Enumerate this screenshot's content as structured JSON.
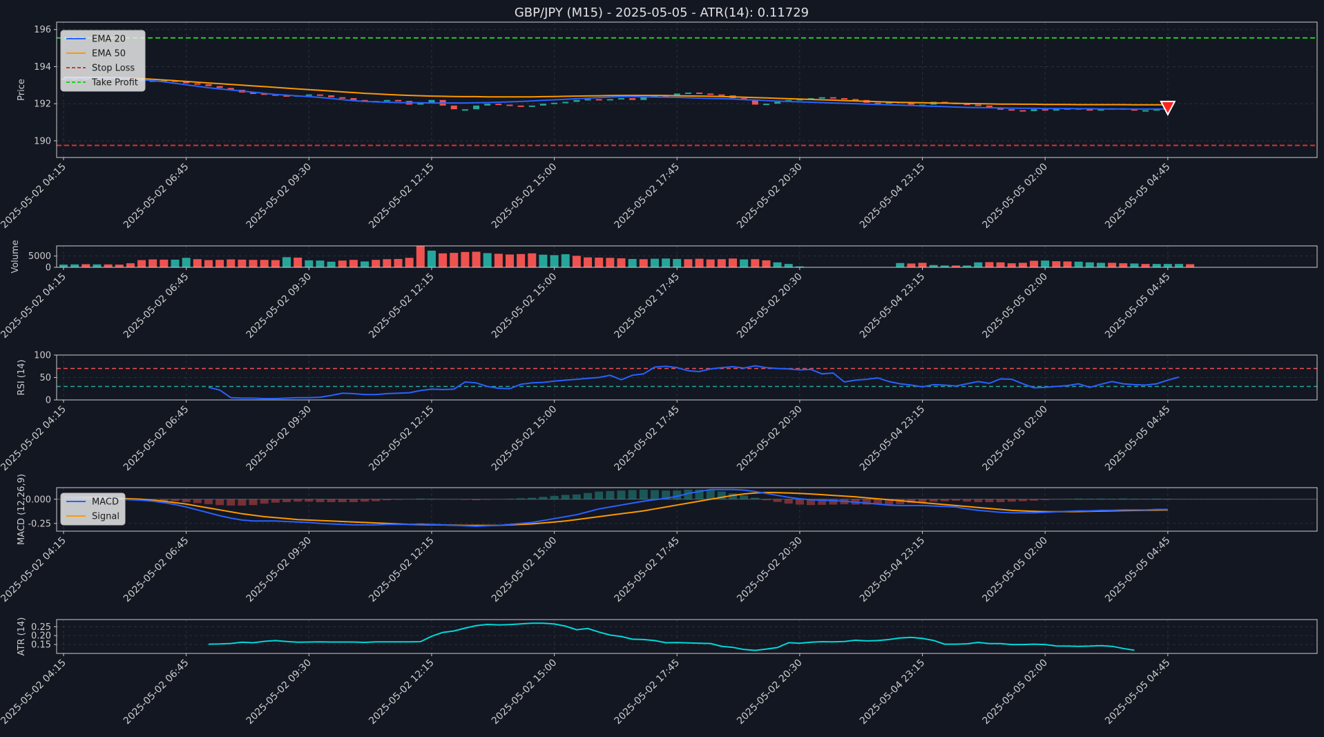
{
  "title": "GBP/JPY (M15) - 2025-05-05 - ATR(14): 0.11729",
  "theme": {
    "background": "#131722",
    "axis_color": "#cccccc",
    "grid_color": "#2a2f3d",
    "up_color": "#26a69a",
    "down_color": "#ef5350",
    "ema20_color": "#2962ff",
    "ema50_color": "#ff9800",
    "stop_loss_color": "#e03030",
    "take_profit_color": "#22cc22",
    "rsi_upper_color": "#ef5350",
    "rsi_lower_color": "#26a69a",
    "atr_color": "#00d9d9"
  },
  "x_ticks": [
    "2025-05-02 04:15",
    "2025-05-02 06:45",
    "2025-05-02 09:30",
    "2025-05-02 12:15",
    "2025-05-02 15:00",
    "2025-05-02 17:45",
    "2025-05-02 20:30",
    "2025-05-04 23:15",
    "2025-05-05 02:00",
    "2025-05-05 04:45"
  ],
  "chart_data": [
    {
      "type": "candlestick",
      "ylabel": "Price",
      "ylim": [
        189.1,
        196.4
      ],
      "yticks": [
        190,
        192,
        194,
        196
      ],
      "legend": [
        "EMA 20",
        "EMA 50",
        "Stop Loss",
        "Take Profit"
      ],
      "legend_position": "top-left",
      "stop_loss": 189.75,
      "take_profit": 195.55,
      "signal_marker": {
        "type": "sell",
        "bar": 99,
        "price": 191.75
      },
      "close": [
        193.35,
        193.35,
        193.35,
        193.35,
        193.3,
        193.3,
        193.3,
        193.25,
        193.25,
        193.25,
        193.2,
        193.1,
        193.05,
        192.95,
        192.85,
        192.75,
        192.6,
        192.55,
        192.5,
        192.45,
        192.4,
        192.45,
        192.5,
        192.45,
        192.35,
        192.3,
        192.2,
        192.1,
        192.15,
        192.2,
        192.15,
        191.95,
        192.05,
        192.2,
        191.9,
        191.7,
        191.7,
        191.9,
        192.0,
        191.95,
        191.9,
        191.85,
        191.9,
        192.0,
        192.05,
        192.1,
        192.2,
        192.25,
        192.2,
        192.25,
        192.3,
        192.2,
        192.35,
        192.45,
        192.4,
        192.55,
        192.6,
        192.55,
        192.5,
        192.45,
        192.3,
        192.2,
        191.95,
        192.0,
        192.1,
        192.2,
        192.25,
        192.3,
        192.35,
        192.3,
        192.25,
        192.2,
        192.05,
        192.0,
        192.1,
        192.05,
        191.95,
        191.95,
        192.1,
        192.05,
        192.0,
        191.95,
        191.9,
        191.75,
        191.7,
        191.65,
        191.6,
        191.7,
        191.65,
        191.7,
        191.75,
        191.7,
        191.65,
        191.7,
        191.75,
        191.7,
        191.65,
        191.65,
        191.7,
        191.75
      ],
      "ema20": [
        193.35,
        193.35,
        193.35,
        193.35,
        193.35,
        193.34,
        193.32,
        193.28,
        193.24,
        193.18,
        193.1,
        193.02,
        192.94,
        192.86,
        192.8,
        192.74,
        192.68,
        192.62,
        192.56,
        192.5,
        192.46,
        192.42,
        192.38,
        192.34,
        192.28,
        192.22,
        192.16,
        192.12,
        192.1,
        192.08,
        192.06,
        192.05,
        192.05,
        192.04,
        192.04,
        192.04,
        192.04,
        192.05,
        192.06,
        192.08,
        192.1,
        192.12,
        192.15,
        192.18,
        192.21,
        192.24,
        192.27,
        192.3,
        192.33,
        192.36,
        192.38,
        192.38,
        192.37,
        192.36,
        192.35,
        192.34,
        192.32,
        192.3,
        192.28,
        192.27,
        192.25,
        192.22,
        192.2,
        192.17,
        192.14,
        192.12,
        192.1,
        192.08,
        192.06,
        192.04,
        192.02,
        192.0,
        191.98,
        191.96,
        191.94,
        191.92,
        191.9,
        191.88,
        191.86,
        191.84,
        191.82,
        191.8,
        191.79,
        191.78,
        191.77,
        191.76,
        191.75,
        191.75,
        191.74,
        191.74,
        191.74,
        191.73,
        191.73,
        191.72,
        191.72,
        191.72,
        191.71,
        191.71,
        191.71,
        191.71
      ],
      "ema50": [
        193.42,
        193.42,
        193.42,
        193.42,
        193.41,
        193.4,
        193.38,
        193.35,
        193.32,
        193.28,
        193.24,
        193.2,
        193.16,
        193.12,
        193.08,
        193.04,
        193.0,
        192.96,
        192.92,
        192.88,
        192.84,
        192.8,
        192.76,
        192.72,
        192.68,
        192.64,
        192.6,
        192.56,
        192.53,
        192.5,
        192.47,
        192.45,
        192.43,
        192.41,
        192.4,
        192.39,
        192.38,
        192.38,
        192.37,
        192.37,
        192.37,
        192.37,
        192.37,
        192.38,
        192.39,
        192.4,
        192.41,
        192.42,
        192.43,
        192.44,
        192.45,
        192.45,
        192.45,
        192.45,
        192.44,
        192.43,
        192.42,
        192.41,
        192.4,
        192.39,
        192.37,
        192.35,
        192.33,
        192.31,
        192.29,
        192.27,
        192.25,
        192.23,
        192.21,
        192.19,
        192.17,
        192.15,
        192.13,
        192.11,
        192.09,
        192.07,
        192.06,
        192.05,
        192.04,
        192.03,
        192.02,
        192.01,
        192.0,
        191.99,
        191.98,
        191.98,
        191.97,
        191.97,
        191.96,
        191.96,
        191.96,
        191.95,
        191.95,
        191.95,
        191.95,
        191.95,
        191.94,
        191.94,
        191.94,
        191.94
      ]
    },
    {
      "type": "bar",
      "ylabel": "Volume",
      "ylim": [
        0,
        9500
      ],
      "yticks": [
        0,
        5000
      ],
      "values": [
        1200,
        1300,
        1400,
        1300,
        1300,
        1200,
        1800,
        3200,
        3500,
        3400,
        3400,
        4200,
        3600,
        3200,
        3300,
        3500,
        3400,
        3300,
        3300,
        3200,
        4500,
        4300,
        3100,
        3000,
        2500,
        3000,
        3300,
        2600,
        3300,
        3600,
        3700,
        4200,
        9400,
        7400,
        6200,
        6400,
        6800,
        6900,
        6300,
        6000,
        5700,
        5900,
        6200,
        5600,
        5400,
        5800,
        5100,
        4400,
        4300,
        4200,
        4000,
        3700,
        3600,
        3800,
        3900,
        3700,
        3600,
        3800,
        3500,
        3600,
        3900,
        3500,
        3600,
        3100,
        2200,
        1500,
        400,
        null,
        null,
        null,
        null,
        null,
        null,
        null,
        null,
        1900,
        1700,
        2000,
        1000,
        800,
        800,
        800,
        2200,
        2300,
        2200,
        1800,
        2000,
        2900,
        3000,
        2700,
        2600,
        2500,
        2200,
        2000,
        2000,
        1800,
        1700,
        1500,
        1500,
        1500,
        1500,
        1400
      ],
      "up": [
        true,
        true,
        false,
        true,
        false,
        false,
        false,
        false,
        false,
        false,
        true,
        true,
        false,
        false,
        false,
        false,
        false,
        false,
        false,
        false,
        true,
        false,
        true,
        true,
        true,
        false,
        false,
        true,
        false,
        false,
        false,
        false,
        false,
        true,
        false,
        false,
        false,
        false,
        true,
        false,
        false,
        false,
        false,
        true,
        true,
        true,
        false,
        false,
        false,
        false,
        false,
        true,
        false,
        true,
        true,
        true,
        false,
        false,
        false,
        false,
        false,
        true,
        false,
        false,
        true,
        true,
        true,
        false,
        false,
        false,
        false,
        false,
        false,
        false,
        false,
        true,
        false,
        false,
        true,
        true,
        false,
        true,
        true,
        false,
        false,
        false,
        false,
        false,
        true,
        false,
        false,
        true,
        true,
        true,
        false,
        false,
        true,
        false,
        true,
        true,
        true,
        false
      ]
    },
    {
      "type": "line",
      "ylabel": "RSI (14)",
      "ylim": [
        0,
        100
      ],
      "yticks": [
        0,
        50,
        100
      ],
      "upper": 70,
      "lower": 30,
      "values": [
        null,
        null,
        null,
        null,
        null,
        null,
        null,
        null,
        null,
        null,
        null,
        null,
        null,
        28,
        22,
        5,
        4,
        4,
        3,
        3,
        4,
        5,
        5,
        6,
        10,
        15,
        14,
        12,
        12,
        14,
        15,
        16,
        21,
        24,
        23,
        24,
        40,
        38,
        30,
        26,
        25,
        35,
        38,
        39,
        42,
        44,
        46,
        48,
        50,
        55,
        45,
        55,
        58,
        73,
        75,
        72,
        65,
        63,
        69,
        72,
        74,
        71,
        76,
        72,
        70,
        69,
        67,
        68,
        58,
        60,
        40,
        44,
        46,
        49,
        41,
        36,
        33,
        29,
        34,
        33,
        31,
        36,
        41,
        37,
        47,
        46,
        36,
        27,
        28,
        30,
        32,
        36,
        28,
        35,
        41,
        36,
        34,
        33,
        36,
        44,
        51
      ],
      "x_start": 13
    },
    {
      "type": "line",
      "ylabel": "MACD (12,26,9)",
      "ylim": [
        -0.33,
        0.12
      ],
      "yticks": [
        0.0,
        -0.25
      ],
      "legend": [
        "MACD",
        "Signal"
      ],
      "legend_position": "top-left",
      "macd": [
        0.02,
        0.02,
        0.015,
        0.01,
        0.005,
        0.0,
        -0.005,
        -0.01,
        -0.02,
        -0.035,
        -0.055,
        -0.08,
        -0.11,
        -0.14,
        -0.17,
        -0.195,
        -0.215,
        -0.225,
        -0.225,
        -0.225,
        -0.23,
        -0.235,
        -0.24,
        -0.25,
        -0.255,
        -0.26,
        -0.265,
        -0.265,
        -0.265,
        -0.26,
        -0.26,
        -0.26,
        -0.255,
        -0.26,
        -0.265,
        -0.27,
        -0.275,
        -0.28,
        -0.275,
        -0.27,
        -0.26,
        -0.25,
        -0.24,
        -0.22,
        -0.2,
        -0.18,
        -0.16,
        -0.13,
        -0.1,
        -0.08,
        -0.06,
        -0.04,
        -0.02,
        -0.005,
        0.01,
        0.03,
        0.06,
        0.08,
        0.1,
        0.1,
        0.1,
        0.095,
        0.08,
        0.06,
        0.04,
        0.02,
        0.005,
        -0.005,
        -0.01,
        -0.015,
        -0.02,
        -0.03,
        -0.04,
        -0.05,
        -0.06,
        -0.065,
        -0.065,
        -0.065,
        -0.07,
        -0.075,
        -0.08,
        -0.1,
        -0.115,
        -0.125,
        -0.135,
        -0.14,
        -0.14,
        -0.14,
        -0.135,
        -0.13,
        -0.125,
        -0.12,
        -0.12,
        -0.115,
        -0.115,
        -0.11,
        -0.11,
        -0.11,
        -0.105,
        -0.105
      ],
      "signal": [
        0.02,
        0.02,
        0.02,
        0.02,
        0.015,
        0.01,
        0.005,
        0.0,
        -0.01,
        -0.02,
        -0.035,
        -0.05,
        -0.07,
        -0.09,
        -0.11,
        -0.13,
        -0.15,
        -0.165,
        -0.18,
        -0.19,
        -0.2,
        -0.21,
        -0.215,
        -0.22,
        -0.225,
        -0.23,
        -0.235,
        -0.24,
        -0.245,
        -0.25,
        -0.255,
        -0.26,
        -0.262,
        -0.264,
        -0.266,
        -0.268,
        -0.27,
        -0.27,
        -0.27,
        -0.27,
        -0.265,
        -0.26,
        -0.255,
        -0.245,
        -0.235,
        -0.225,
        -0.21,
        -0.195,
        -0.18,
        -0.165,
        -0.15,
        -0.135,
        -0.12,
        -0.1,
        -0.08,
        -0.06,
        -0.04,
        -0.02,
        0.0,
        0.02,
        0.04,
        0.055,
        0.065,
        0.07,
        0.068,
        0.065,
        0.06,
        0.055,
        0.048,
        0.04,
        0.032,
        0.025,
        0.015,
        0.005,
        -0.005,
        -0.015,
        -0.025,
        -0.035,
        -0.045,
        -0.055,
        -0.065,
        -0.075,
        -0.085,
        -0.095,
        -0.105,
        -0.115,
        -0.12,
        -0.125,
        -0.128,
        -0.128,
        -0.128,
        -0.127,
        -0.125,
        -0.122,
        -0.12,
        -0.118,
        -0.116,
        -0.114,
        -0.112,
        -0.11
      ],
      "hist": [
        0,
        0,
        -0.005,
        -0.01,
        -0.01,
        -0.01,
        -0.01,
        -0.01,
        -0.01,
        -0.015,
        -0.02,
        -0.03,
        -0.04,
        -0.05,
        -0.06,
        -0.065,
        -0.065,
        -0.06,
        -0.045,
        -0.035,
        -0.03,
        -0.025,
        -0.025,
        -0.03,
        -0.03,
        -0.03,
        -0.03,
        -0.025,
        -0.02,
        -0.01,
        -0.005,
        0,
        0.007,
        0.004,
        0.001,
        -0.002,
        -0.005,
        -0.01,
        -0.005,
        0,
        0.005,
        0.01,
        0.015,
        0.025,
        0.035,
        0.045,
        0.05,
        0.065,
        0.08,
        0.085,
        0.09,
        0.095,
        0.1,
        0.095,
        0.09,
        0.09,
        0.1,
        0.1,
        0.1,
        0.08,
        0.06,
        0.04,
        0.015,
        -0.01,
        -0.028,
        -0.045,
        -0.055,
        -0.06,
        -0.058,
        -0.055,
        -0.052,
        -0.055,
        -0.055,
        -0.055,
        -0.055,
        -0.05,
        -0.04,
        -0.03,
        -0.025,
        -0.02,
        -0.015,
        -0.025,
        -0.03,
        -0.03,
        -0.03,
        -0.025,
        -0.02,
        -0.015,
        -0.007,
        -0.002,
        0.003,
        0.007,
        0.005,
        0.007,
        0.005,
        0.008,
        0.006,
        0.004,
        0.007,
        0.005
      ]
    },
    {
      "type": "line",
      "ylabel": "ATR (14)",
      "ylim": [
        0.1,
        0.29
      ],
      "yticks": [
        0.15,
        0.2,
        0.25
      ],
      "x_start": 13,
      "values": [
        null,
        null,
        null,
        null,
        null,
        null,
        null,
        null,
        null,
        null,
        null,
        null,
        null,
        0.152,
        0.153,
        0.156,
        0.163,
        0.16,
        0.168,
        0.172,
        0.167,
        0.163,
        0.164,
        0.165,
        0.164,
        0.164,
        0.164,
        0.162,
        0.165,
        0.165,
        0.165,
        0.165,
        0.166,
        0.196,
        0.218,
        0.226,
        0.242,
        0.256,
        0.263,
        0.26,
        0.262,
        0.266,
        0.27,
        0.27,
        0.265,
        0.253,
        0.233,
        0.24,
        0.22,
        0.203,
        0.195,
        0.18,
        0.178,
        0.172,
        0.16,
        0.161,
        0.159,
        0.157,
        0.156,
        0.14,
        0.134,
        0.122,
        0.117,
        0.124,
        0.133,
        0.16,
        0.157,
        0.163,
        0.166,
        0.165,
        0.167,
        0.174,
        0.17,
        0.172,
        0.178,
        0.187,
        0.19,
        0.184,
        0.173,
        0.152,
        0.152,
        0.154,
        0.162,
        0.155,
        0.155,
        0.15,
        0.15,
        0.152,
        0.15,
        0.142,
        0.141,
        0.14,
        0.141,
        0.144,
        0.14,
        0.128,
        0.118
      ]
    }
  ]
}
